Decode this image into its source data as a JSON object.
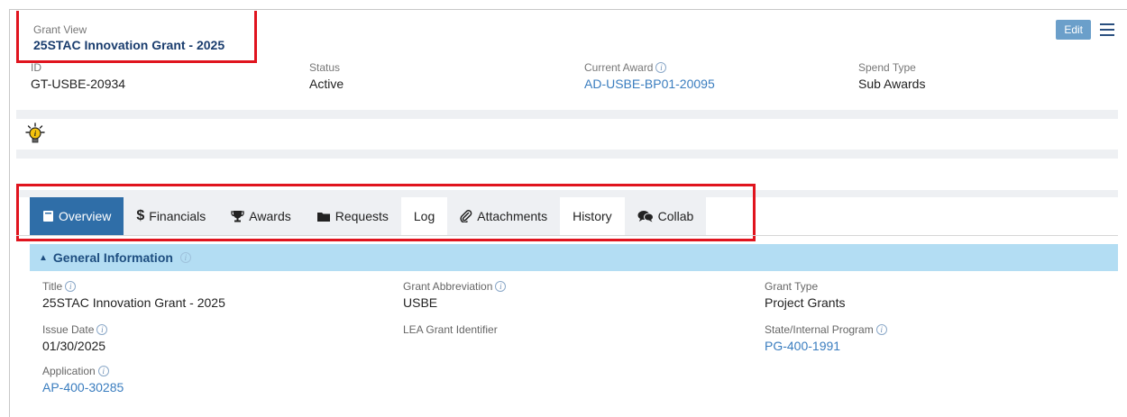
{
  "header": {
    "label": "Grant View",
    "title": "25STAC Innovation Grant - 2025",
    "edit_label": "Edit"
  },
  "info": {
    "id_label": "ID",
    "id_value": "GT-USBE-20934",
    "status_label": "Status",
    "status_value": "Active",
    "award_label": "Current Award",
    "award_value": "AD-USBE-BP01-20095",
    "spend_label": "Spend Type",
    "spend_value": "Sub Awards"
  },
  "tabs": [
    {
      "label": "Overview",
      "icon": "book-icon"
    },
    {
      "label": "Financials",
      "icon": "dollar-icon"
    },
    {
      "label": "Awards",
      "icon": "trophy-icon"
    },
    {
      "label": "Requests",
      "icon": "folder-icon"
    },
    {
      "label": "Log",
      "icon": ""
    },
    {
      "label": "Attachments",
      "icon": "paperclip-icon"
    },
    {
      "label": "History",
      "icon": ""
    },
    {
      "label": "Collab",
      "icon": "chat-icon"
    }
  ],
  "general": {
    "title": "General Information",
    "title_label": "Title",
    "title_value": "25STAC Innovation Grant - 2025",
    "abbr_label": "Grant Abbreviation",
    "abbr_value": "USBE",
    "type_label": "Grant Type",
    "type_value": "Project Grants",
    "issue_label": "Issue Date",
    "issue_value": "01/30/2025",
    "lea_label": "LEA Grant Identifier",
    "program_label": "State/Internal Program",
    "program_value": "PG-400-1991",
    "application_label": "Application",
    "application_value": "AP-400-30285"
  },
  "colors": {
    "active_tab": "#2f6ea8",
    "link": "#3a7dbf",
    "highlight_border": "#e0141e",
    "section_bar": "#b3ddf3"
  }
}
